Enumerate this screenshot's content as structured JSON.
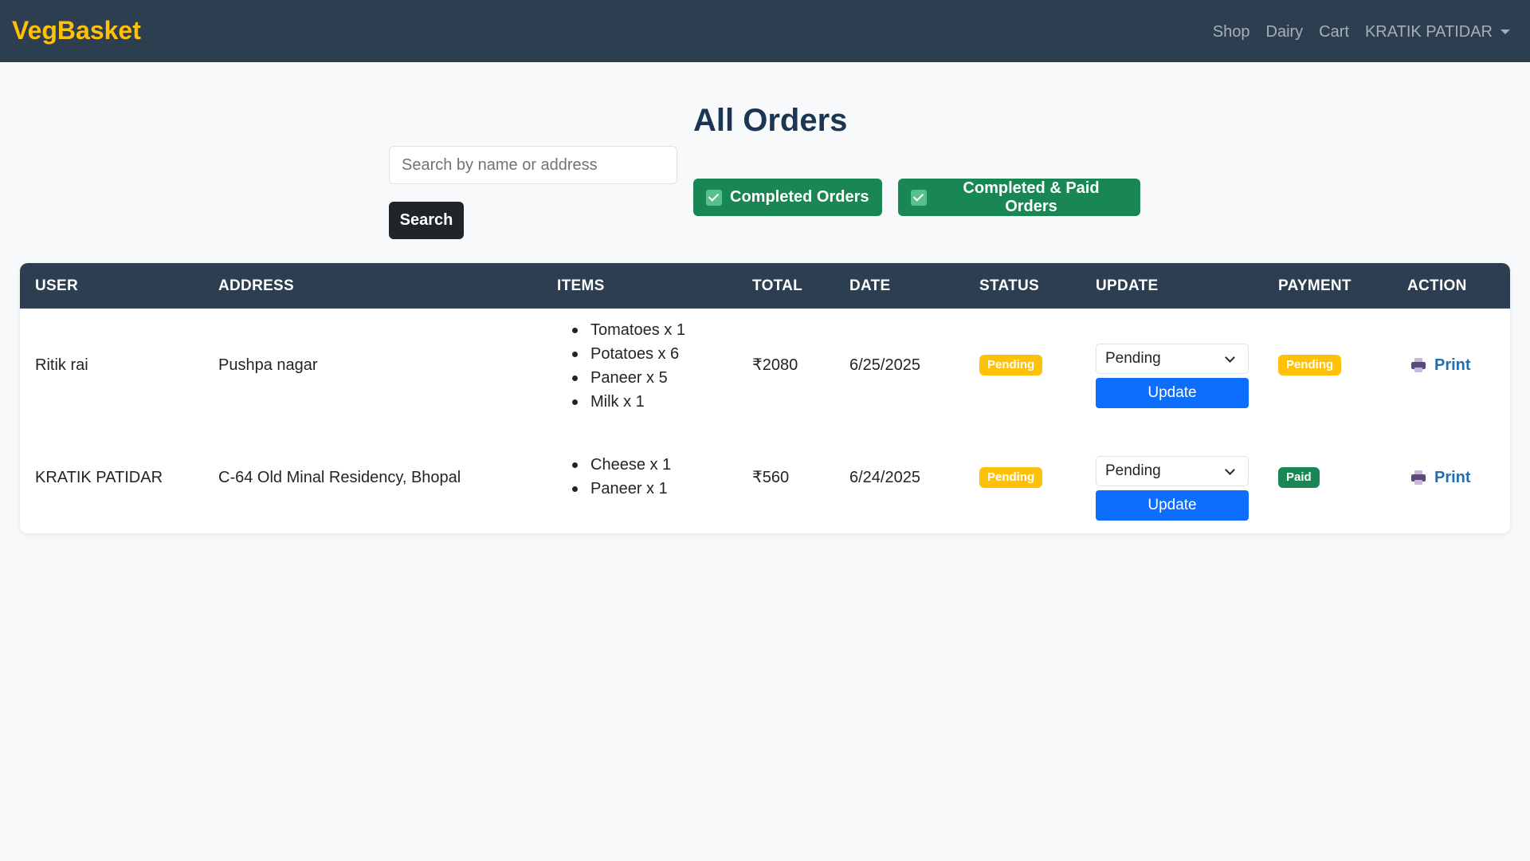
{
  "navbar": {
    "brand": "VegBasket",
    "links": [
      "Shop",
      "Dairy",
      "Cart"
    ],
    "user": "KRATIK PATIDAR"
  },
  "page": {
    "title": "All Orders"
  },
  "search": {
    "placeholder": "Search by name or address",
    "button": "Search"
  },
  "filters": {
    "completed": "Completed Orders",
    "completed_paid": "Completed & Paid Orders"
  },
  "table": {
    "headers": [
      "USER",
      "ADDRESS",
      "ITEMS",
      "TOTAL",
      "DATE",
      "STATUS",
      "UPDATE",
      "PAYMENT",
      "ACTION"
    ],
    "rows": [
      {
        "user": "Ritik rai",
        "address": "Pushpa nagar",
        "items": [
          "Tomatoes x 1",
          "Potatoes x 6",
          "Paneer x 5",
          "Milk x 1"
        ],
        "total": "₹2080",
        "date": "6/25/2025",
        "status": "Pending",
        "select_value": "Pending",
        "update": "Update",
        "payment": "Pending",
        "action": "Print"
      },
      {
        "user": "KRATIK PATIDAR",
        "address": "C-64 Old Minal Residency, Bhopal",
        "items": [
          "Cheese x 1",
          "Paneer x 1"
        ],
        "total": "₹560",
        "date": "6/24/2025",
        "status": "Pending",
        "select_value": "Pending",
        "update": "Update",
        "payment": "Paid",
        "action": "Print"
      }
    ]
  },
  "colors": {
    "navbar": "#2c3e50",
    "brand": "#ffc107",
    "success": "#198754",
    "primary": "#0d6efd",
    "warning": "#ffc107"
  }
}
